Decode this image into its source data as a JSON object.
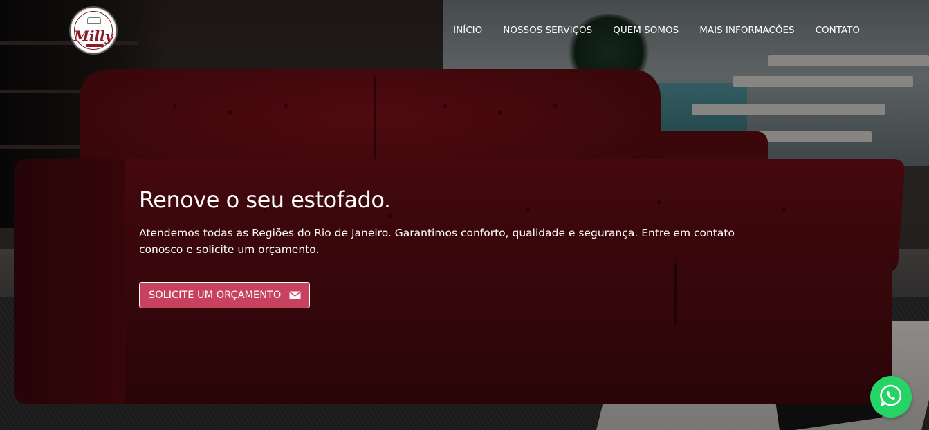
{
  "brand": {
    "logo_text": "Milly"
  },
  "nav": {
    "items": [
      {
        "label": "INÍCIO"
      },
      {
        "label": "NOSSOS SERVIÇOS"
      },
      {
        "label": "QUEM SOMOS"
      },
      {
        "label": "MAIS INFORMAÇÕES"
      },
      {
        "label": "CONTATO"
      }
    ]
  },
  "hero": {
    "title": "Renove o seu estofado.",
    "description": "Atendemos todas as Regiões do Rio de Janeiro. Garantimos conforto, qualidade e segurança. Entre em contato conosco e solicite um orçamento.",
    "cta_label": "SOLICITE UM ORÇAMENTO",
    "cta_icon": "envelope-icon"
  },
  "floating": {
    "whatsapp_icon": "whatsapp-icon"
  },
  "colors": {
    "accent": "#c8415e",
    "whatsapp": "#25d366",
    "sofa": "#6a0e15"
  }
}
